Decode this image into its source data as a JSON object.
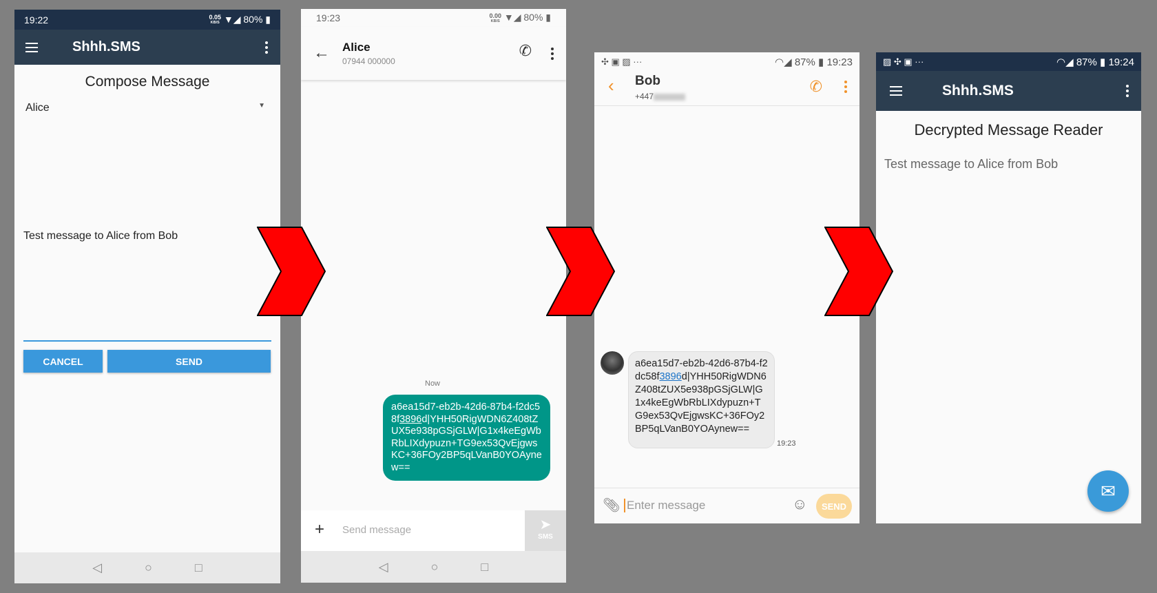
{
  "colors": {
    "appbar": "#2c3e50",
    "statusbar": "#1e3048",
    "accent": "#3a98dc",
    "bubble_sent": "#009688",
    "bubble_received": "#ececec",
    "samsung_accent": "#f0922b",
    "arrow": "#ff0000"
  },
  "panel1": {
    "status": {
      "time": "19:22",
      "speed": "0.05",
      "speed_unit": "KB/S",
      "battery": "80%"
    },
    "app_title": "Shhh.SMS",
    "heading": "Compose Message",
    "recipient": "Alice",
    "message": "Test message to Alice from Bob",
    "cancel_label": "CANCEL",
    "send_label": "SEND"
  },
  "panel2": {
    "status": {
      "time": "19:23",
      "speed": "0.00",
      "speed_unit": "KB/S",
      "battery": "80%"
    },
    "contact_name": "Alice",
    "contact_number": "07944 000000",
    "timestamp": "Now",
    "bubble_pre": "a6ea15d7-eb2b-42d6-87b4-f2dc58f",
    "bubble_link": "3896",
    "bubble_post": "d|YHH50RigWDN6Z408tZUX5e938pGSjGLW|G1x4keEgWbRbLIXdypuzn+TG9ex53QvEjgwsKC+36FOy2BP5qLVanB0YOAynew==",
    "input_placeholder": "Send message",
    "send_label": "SMS"
  },
  "panel3": {
    "status": {
      "battery": "87%",
      "time": "19:23"
    },
    "contact_name": "Bob",
    "contact_number": "+447",
    "bubble_pre": "a6ea15d7-eb2b-42d6-87b4-f2dc58f",
    "bubble_link": "3896",
    "bubble_post": "d|YHH50RigWDN6Z408tZUX5e938pGSjGLW|G1x4keEgWbRbLIXdypuzn+TG9ex53QvEjgwsKC+36FOy2BP5qLVanB0YOAynew==",
    "bubble_time": "19:23",
    "input_placeholder": "Enter message",
    "send_label": "SEND"
  },
  "panel4": {
    "status": {
      "battery": "87%",
      "time": "19:24"
    },
    "app_title": "Shhh.SMS",
    "heading": "Decrypted Message Reader",
    "message": "Test message to Alice from Bob"
  }
}
